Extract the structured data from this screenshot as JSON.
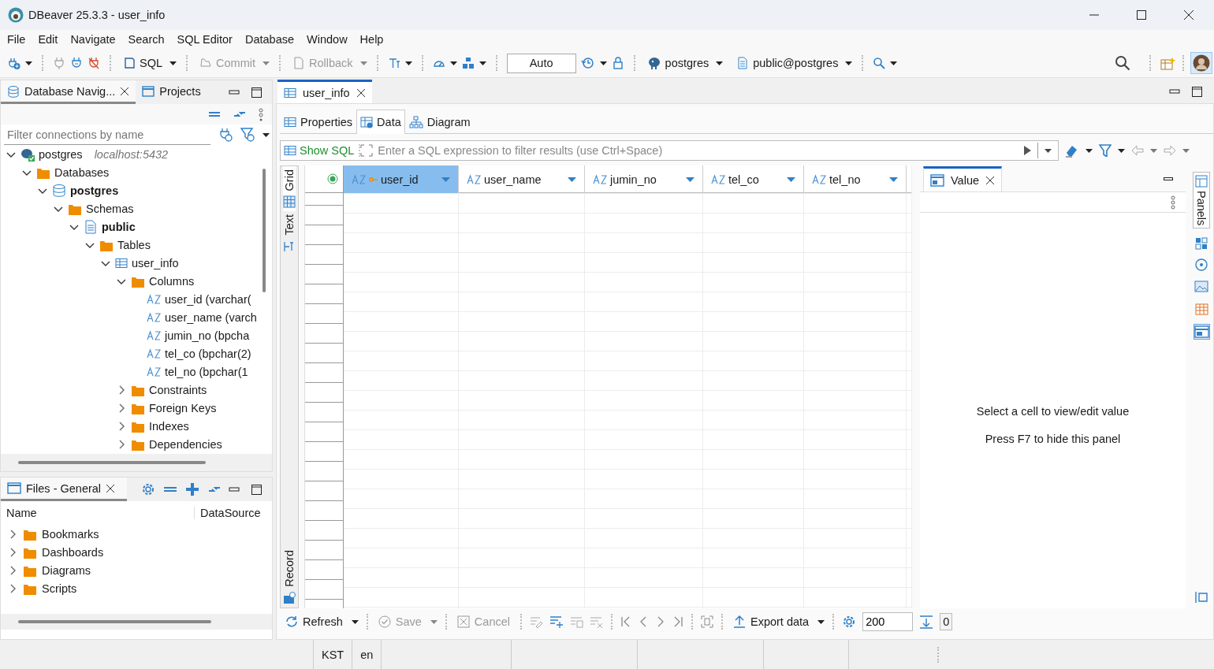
{
  "window": {
    "title": "DBeaver 25.3.3 - user_info"
  },
  "menu": [
    "File",
    "Edit",
    "Navigate",
    "Search",
    "SQL Editor",
    "Database",
    "Window",
    "Help"
  ],
  "toolbar": {
    "buttons": [
      {
        "kind": "sql",
        "label": "SQL",
        "disabled": false
      },
      {
        "kind": "commit",
        "label": "Commit",
        "disabled": true
      },
      {
        "kind": "rollback",
        "label": "Rollback",
        "disabled": true
      }
    ],
    "transaction_mode": "Auto",
    "connection": "postgres",
    "schema": "public@postgres"
  },
  "navigator": {
    "tabs": [
      {
        "label": "Database Navig...",
        "selected": true
      },
      {
        "label": "Projects",
        "selected": false
      }
    ],
    "filter": {
      "placeholder": "Filter connections by name"
    },
    "tree": [
      {
        "kind": "connection",
        "label": "postgres",
        "detail": "localhost:5432",
        "expanded": true,
        "children": [
          {
            "kind": "folder",
            "label": "Databases",
            "expanded": true,
            "children": [
              {
                "kind": "database",
                "label": "postgres",
                "expanded": true,
                "children": [
                  {
                    "kind": "folder",
                    "label": "Schemas",
                    "expanded": true,
                    "children": [
                      {
                        "kind": "schema",
                        "label": "public",
                        "expanded": true,
                        "children": [
                          {
                            "kind": "folder",
                            "label": "Tables",
                            "expanded": true,
                            "children": [
                              {
                                "kind": "table",
                                "label": "user_info",
                                "expanded": true,
                                "children": [
                                  {
                                    "kind": "folder",
                                    "label": "Columns",
                                    "expanded": true,
                                    "children": [
                                      {
                                        "kind": "column",
                                        "label": "user_id (varchar("
                                      },
                                      {
                                        "kind": "column",
                                        "label": "user_name (varch"
                                      },
                                      {
                                        "kind": "column",
                                        "label": "jumin_no (bpcha"
                                      },
                                      {
                                        "kind": "column",
                                        "label": "tel_co (bpchar(2)"
                                      },
                                      {
                                        "kind": "column",
                                        "label": "tel_no (bpchar(1"
                                      }
                                    ]
                                  },
                                  {
                                    "kind": "folder",
                                    "label": "Constraints",
                                    "expanded": false
                                  },
                                  {
                                    "kind": "folder",
                                    "label": "Foreign Keys",
                                    "expanded": false
                                  },
                                  {
                                    "kind": "folder",
                                    "label": "Indexes",
                                    "expanded": false
                                  },
                                  {
                                    "kind": "folder",
                                    "label": "Dependencies",
                                    "expanded": false
                                  }
                                ]
                              }
                            ]
                          }
                        ]
                      }
                    ]
                  }
                ]
              }
            ]
          }
        ]
      }
    ]
  },
  "files": {
    "tabs": [
      {
        "label": "Files - General",
        "selected": true
      }
    ],
    "columns": [
      "Name",
      "DataSource"
    ],
    "items": [
      {
        "label": "Bookmarks",
        "expanded": false
      },
      {
        "label": "Dashboards",
        "expanded": false
      },
      {
        "label": "Diagrams",
        "expanded": false
      },
      {
        "label": "Scripts",
        "expanded": false
      }
    ]
  },
  "editor": {
    "tabs": [
      {
        "label": "user_info",
        "selected": true
      }
    ],
    "subtabs": [
      {
        "kind": "properties",
        "label": "Properties",
        "selected": false
      },
      {
        "kind": "data",
        "label": "Data",
        "selected": true
      },
      {
        "kind": "diagram",
        "label": "Diagram",
        "selected": false
      }
    ],
    "filter": {
      "show_sql": "Show SQL",
      "placeholder": "Enter a SQL expression to filter results (use Ctrl+Space)"
    },
    "views": [
      {
        "kind": "grid",
        "label": "Grid",
        "selected": true
      },
      {
        "kind": "text",
        "label": "Text",
        "selected": false
      },
      {
        "kind": "record",
        "label": "Record",
        "selected": false
      }
    ],
    "columns": [
      {
        "name": "user_id",
        "key": true,
        "selected": true
      },
      {
        "name": "user_name",
        "key": false,
        "selected": false
      },
      {
        "name": "jumin_no",
        "key": false,
        "selected": false
      },
      {
        "name": "tel_co",
        "key": false,
        "selected": false
      },
      {
        "name": "tel_no",
        "key": false,
        "selected": false
      }
    ],
    "value_panel": {
      "tab": "Value",
      "messages": [
        "Select a cell to view/edit value",
        "Press F7 to hide this panel"
      ]
    },
    "panels_label": "Panels",
    "actions": [
      {
        "kind": "refresh",
        "label": "Refresh",
        "disabled": false
      },
      {
        "kind": "save",
        "label": "Save",
        "disabled": true
      },
      {
        "kind": "cancel",
        "label": "Cancel",
        "disabled": true
      },
      {
        "kind": "export",
        "label": "Export data",
        "disabled": false
      }
    ],
    "fetch_size": "200",
    "row_count": "0"
  },
  "status_bar": {
    "timezone": "KST",
    "locale": "en"
  }
}
